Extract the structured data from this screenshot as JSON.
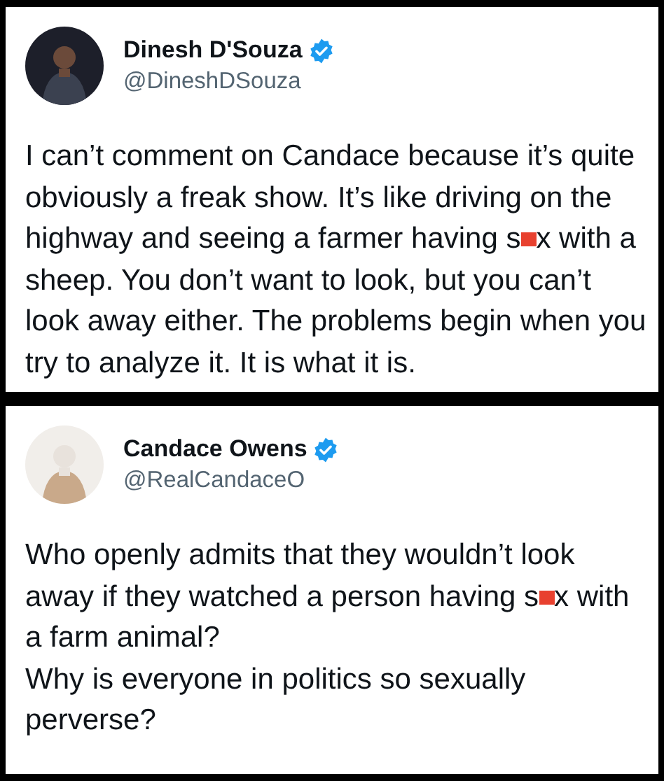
{
  "tweets": [
    {
      "name": "Dinesh D'Souza",
      "verified": true,
      "handle": "@DineshDSouza",
      "paragraphs": [
        [
          "I can’t comment on Candace because it’s quite obviously a freak show. It’s like driving on the highway and seeing a farmer having s",
          "x with a sheep. You don’t want to look, but you can’t look away either. The problems begin when you try to analyze it. It is what it is."
        ]
      ]
    },
    {
      "name": "Candace Owens",
      "verified": true,
      "handle": "@RealCandaceO",
      "paragraphs": [
        [
          "Who openly admits that they wouldn’t look away if they watched a person having s",
          "x with a farm animal?"
        ],
        [
          "Why is everyone in politics so sexually perverse?"
        ]
      ]
    }
  ]
}
